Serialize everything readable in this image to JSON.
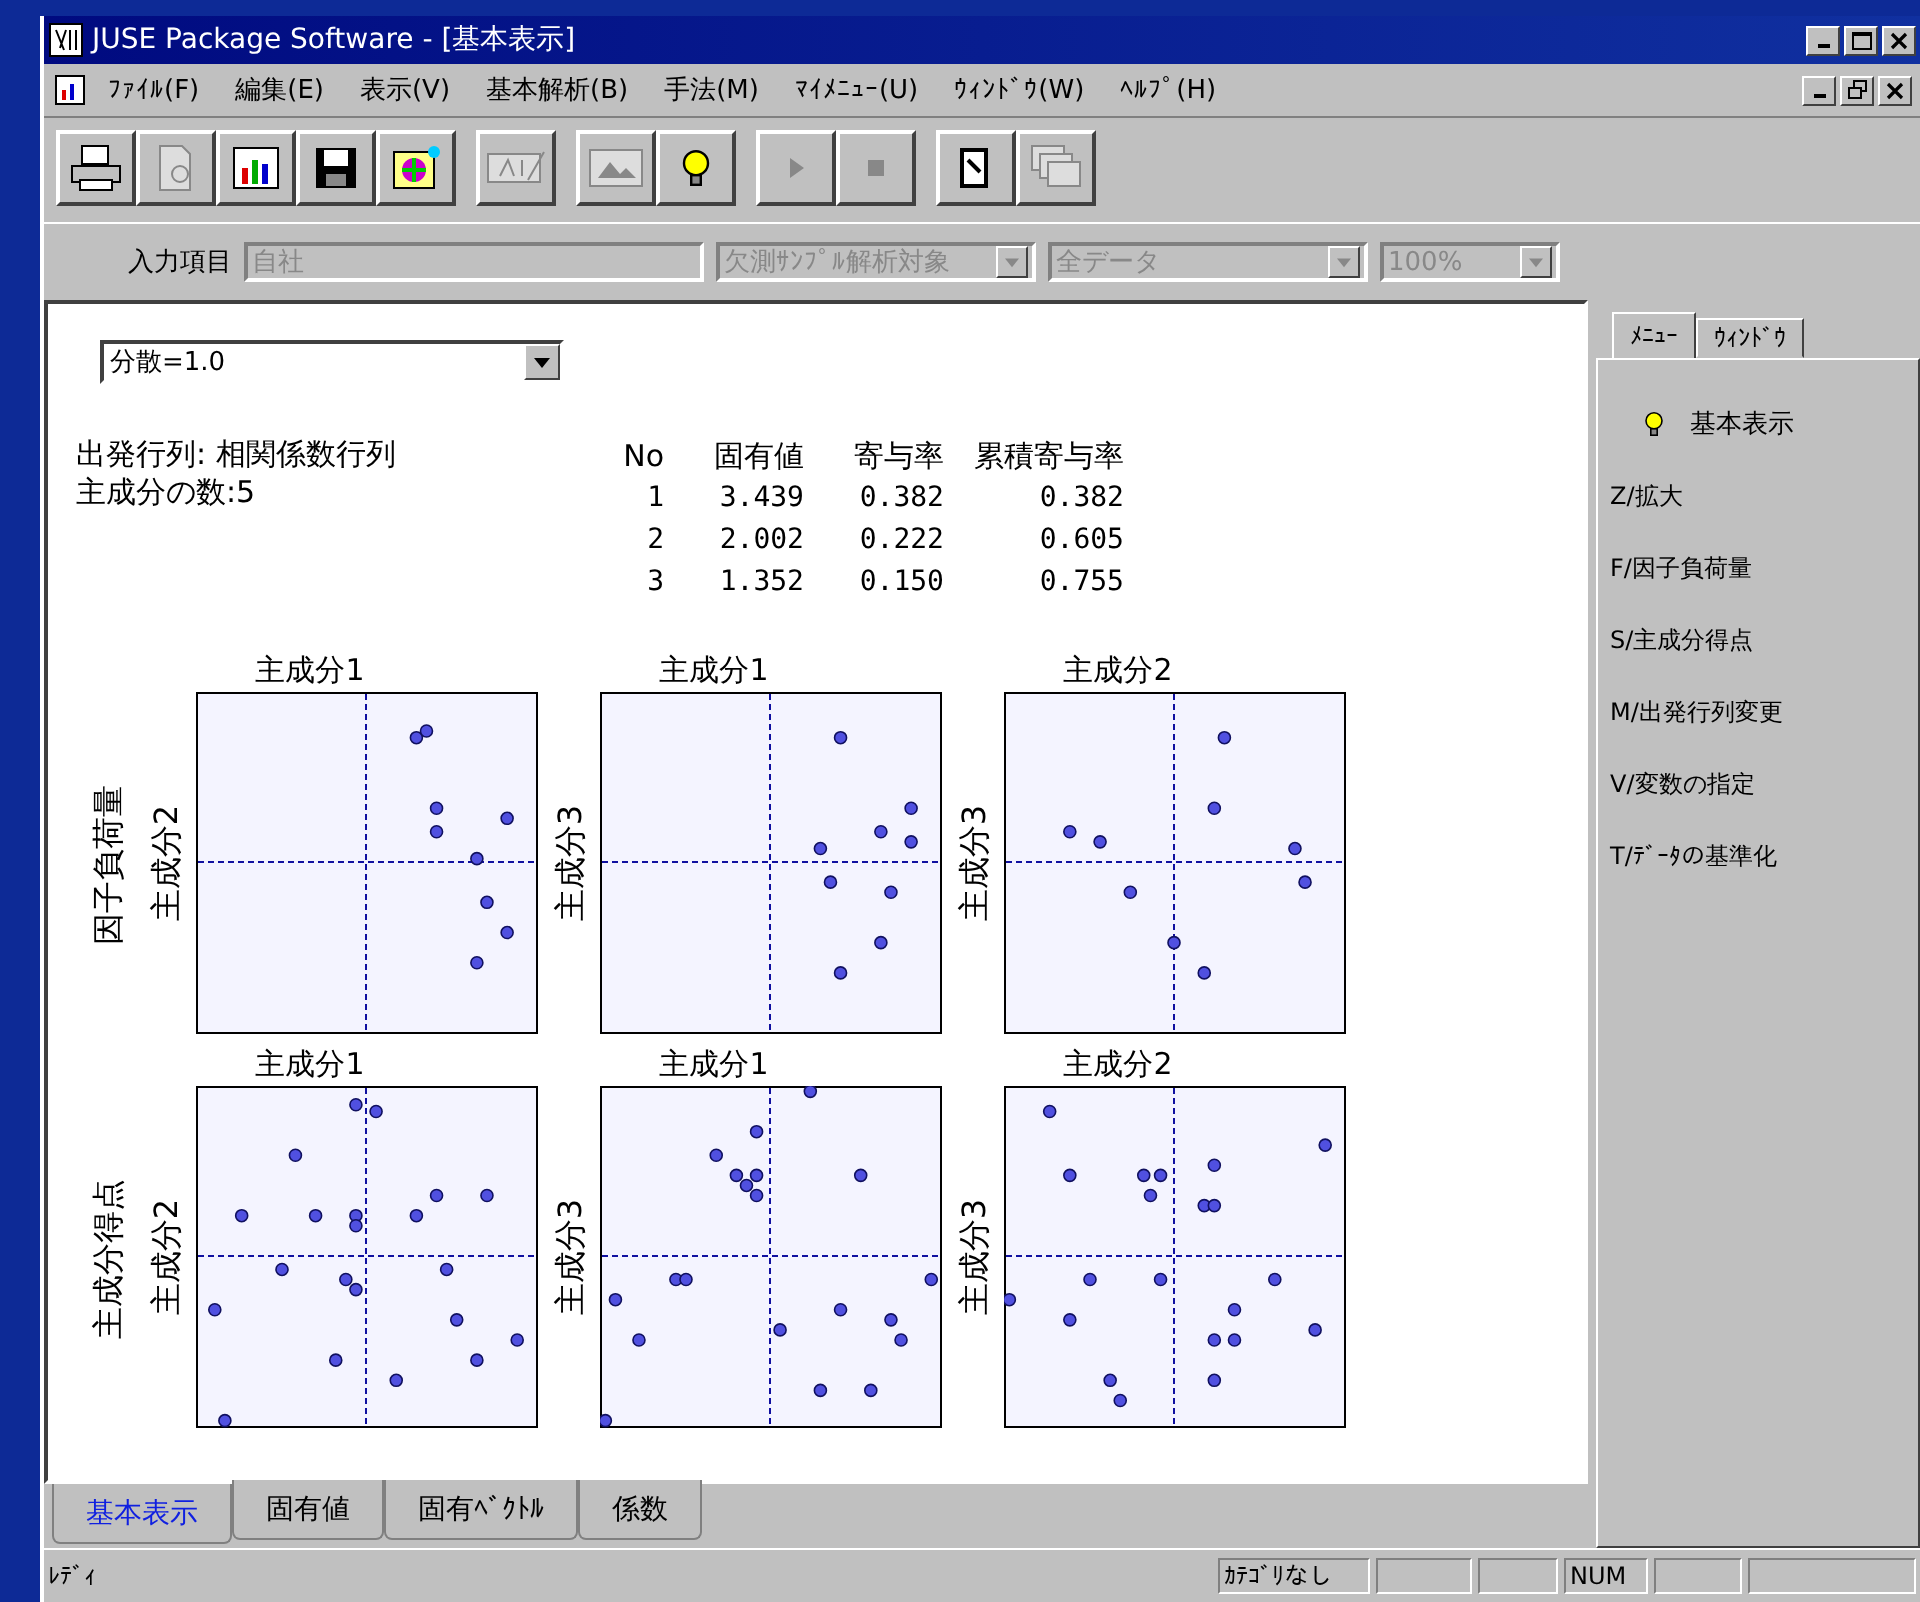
{
  "window": {
    "title": "JUSE Package Software - [基本表示]"
  },
  "menu": [
    "ﾌｧｲﾙ(F)",
    "編集(E)",
    "表示(V)",
    "基本解析(B)",
    "手法(M)",
    "ﾏｲﾒﾆｭｰ(U)",
    "ｳｨﾝﾄﾞｳ(W)",
    "ﾍﾙﾌﾟ(H)"
  ],
  "toolbar": [
    [
      {
        "kind": "printer",
        "disabled": false
      },
      {
        "kind": "preview",
        "disabled": true
      },
      {
        "kind": "chart",
        "disabled": false
      },
      {
        "kind": "save",
        "disabled": false
      },
      {
        "kind": "palette",
        "disabled": false
      }
    ],
    [
      {
        "kind": "text",
        "disabled": true
      }
    ],
    [
      {
        "kind": "image",
        "disabled": true
      },
      {
        "kind": "bulb",
        "disabled": false
      }
    ],
    [
      {
        "kind": "play",
        "disabled": true
      },
      {
        "kind": "stop",
        "disabled": true
      }
    ],
    [
      {
        "kind": "page",
        "disabled": false
      },
      {
        "kind": "windows",
        "disabled": true
      }
    ]
  ],
  "input_row": {
    "label": "入力項目",
    "field": {
      "value": "自社",
      "disabled": true
    },
    "dropdowns": [
      {
        "value": "欠測ｻﾝﾌﾟﾙ解析対象",
        "disabled": true
      },
      {
        "value": "全データ",
        "disabled": true
      },
      {
        "value": "100%",
        "disabled": true
      }
    ]
  },
  "content": {
    "variance_select": "分散=1.0",
    "info": [
      "出発行列: 相関係数行列",
      "主成分の数:5"
    ],
    "eigen_table": {
      "columns": [
        "No",
        "固有値",
        "寄与率",
        "累積寄与率"
      ],
      "rows": [
        [
          "1",
          "3.439",
          "0.382",
          "0.382"
        ],
        [
          "2",
          "2.002",
          "0.222",
          "0.605"
        ],
        [
          "3",
          "1.352",
          "0.150",
          "0.755"
        ]
      ]
    },
    "plot_rows": [
      {
        "label": "因子負荷量",
        "plots": [
          {
            "title": "主成分1",
            "ylabel": "主成分2"
          },
          {
            "title": "主成分1",
            "ylabel": "主成分3"
          },
          {
            "title": "主成分2",
            "ylabel": "主成分3"
          }
        ]
      },
      {
        "label": "主成分得点",
        "plots": [
          {
            "title": "主成分1",
            "ylabel": "主成分2"
          },
          {
            "title": "主成分1",
            "ylabel": "主成分3"
          },
          {
            "title": "主成分2",
            "ylabel": "主成分3"
          }
        ]
      }
    ]
  },
  "bottom_tabs": [
    {
      "label": "基本表示",
      "selected": true
    },
    {
      "label": "固有値",
      "selected": false
    },
    {
      "label": "固有ﾍﾞｸﾄﾙ",
      "selected": false
    },
    {
      "label": "係数",
      "selected": false
    }
  ],
  "side_panel": {
    "tabs": [
      {
        "label": "ﾒﾆｭｰ",
        "selected": true
      },
      {
        "label": "ｳｨﾝﾄﾞｳ",
        "selected": false
      }
    ],
    "items": [
      {
        "label": "基本表示",
        "kind": "bulb"
      },
      {
        "label": "Z/拡大",
        "kind": "plain"
      },
      {
        "label": "F/因子負荷量",
        "kind": "plain"
      },
      {
        "label": "S/主成分得点",
        "kind": "plain"
      },
      {
        "label": "M/出発行列変更",
        "kind": "plain"
      },
      {
        "label": "V/変数の指定",
        "kind": "plain"
      },
      {
        "label": "T/ﾃﾞｰﾀの基準化",
        "kind": "plain"
      }
    ]
  },
  "status_bar": {
    "message": "ﾚﾃﾞｨ",
    "panes": [
      "ｶﾃｺﾞﾘなし",
      "NUM"
    ]
  }
}
